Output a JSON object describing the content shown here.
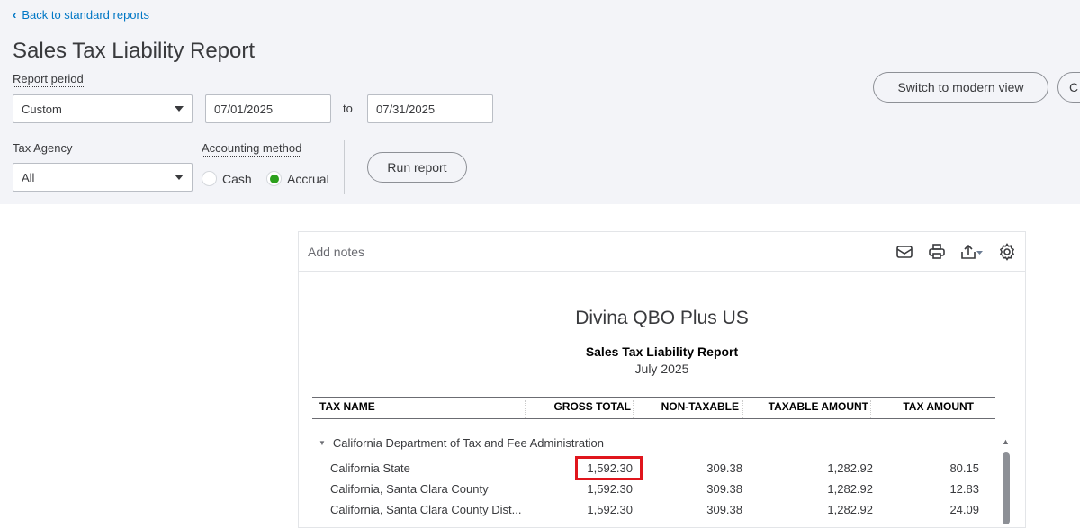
{
  "nav": {
    "back_label": "Back to standard reports"
  },
  "header": {
    "title": "Sales Tax Liability Report"
  },
  "filters": {
    "report_period_label": "Report period",
    "report_period_value": "Custom",
    "start_date": "07/01/2025",
    "to_label": "to",
    "end_date": "07/31/2025",
    "tax_agency_label": "Tax Agency",
    "tax_agency_value": "All",
    "accounting_method_label": "Accounting method",
    "cash_label": "Cash",
    "accrual_label": "Accrual",
    "selected_method": "Accrual",
    "run_report_label": "Run report"
  },
  "actions": {
    "switch_view_label": "Switch to modern view",
    "partial_button_label": "C"
  },
  "report": {
    "add_notes_label": "Add notes",
    "company": "Divina QBO Plus US",
    "name": "Sales Tax Liability Report",
    "period": "July 2025",
    "columns": [
      "TAX NAME",
      "GROSS TOTAL",
      "NON-TAXABLE",
      "TAXABLE AMOUNT",
      "TAX AMOUNT"
    ],
    "group": "California Department of Tax and Fee Administration",
    "rows": [
      {
        "name": "California State",
        "gross": "1,592.30",
        "nontax": "309.38",
        "taxable": "1,282.92",
        "tax": "80.15"
      },
      {
        "name": "California, Santa Clara County",
        "gross": "1,592.30",
        "nontax": "309.38",
        "taxable": "1,282.92",
        "tax": "12.83"
      },
      {
        "name": "California, Santa Clara County Dist...",
        "gross": "1,592.30",
        "nontax": "309.38",
        "taxable": "1,282.92",
        "tax": "24.09"
      }
    ]
  },
  "colors": {
    "accent": "#0077c5",
    "radio": "#2ca01c",
    "highlight": "#e0161d"
  }
}
